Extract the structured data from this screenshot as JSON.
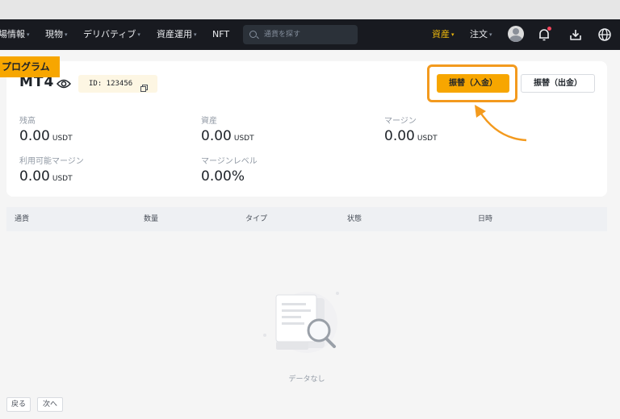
{
  "nav": {
    "items": [
      {
        "label": "場情報",
        "caret": "▾"
      },
      {
        "label": "現物",
        "caret": "▾"
      },
      {
        "label": "デリバティブ",
        "caret": "▾"
      },
      {
        "label": "資産運用",
        "caret": "▾"
      },
      {
        "label": "NFT",
        "caret": ""
      }
    ],
    "search_placeholder": "通貨を探す",
    "assets_label": "資産",
    "orders_label": "注文",
    "caret": "▾"
  },
  "account": {
    "badge": "プログラム",
    "name": "MT4",
    "id_text": "ID: 123456",
    "deposit_button": "振替（入金）",
    "withdraw_button": "振替（出金）"
  },
  "stats": [
    {
      "label": "残高",
      "value": "0.00",
      "unit": "USDT"
    },
    {
      "label": "資産",
      "value": "0.00",
      "unit": "USDT"
    },
    {
      "label": "マージン",
      "value": "0.00",
      "unit": "USDT"
    },
    {
      "label": "利用可能マージン",
      "value": "0.00",
      "unit": "USDT"
    },
    {
      "label": "マージンレベル",
      "value": "0.00%",
      "unit": ""
    }
  ],
  "table": {
    "columns": [
      "通貨",
      "数量",
      "タイプ",
      "状態",
      "日時"
    ],
    "empty_text": "データなし"
  },
  "pagination": {
    "prev": "戻る",
    "next": "次へ"
  },
  "colors": {
    "accent": "#f7a600",
    "highlight": "#f39a1e",
    "nav_bg": "#181a20"
  }
}
